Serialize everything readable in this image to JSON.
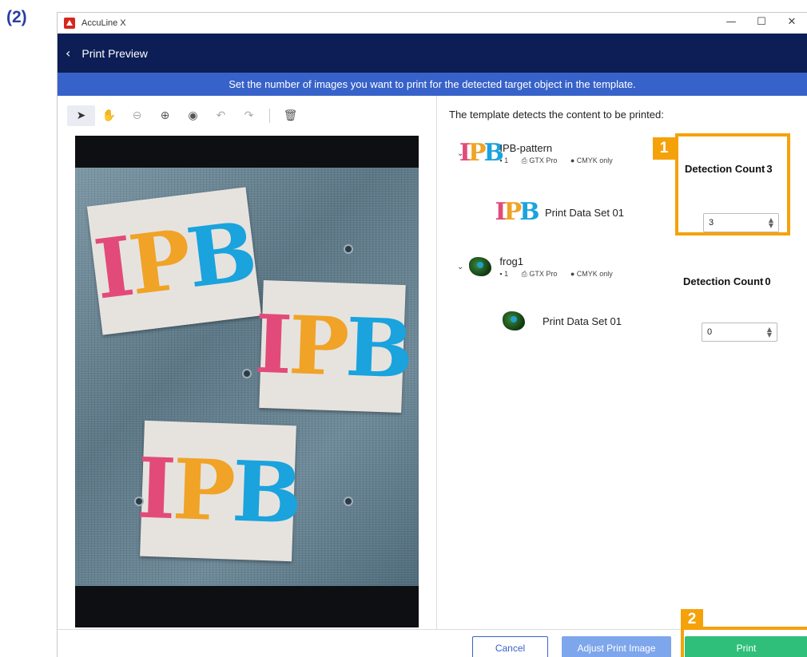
{
  "step_label": "(2)",
  "window": {
    "title": "AccuLine X",
    "controls": [
      "—",
      "☐",
      "✕"
    ]
  },
  "nav": {
    "back_icon": "‹",
    "title": "Print Preview"
  },
  "banner_text": "Set the number of images you want to print for the detected target object in the template.",
  "toolbar": {
    "tools": [
      {
        "name": "select-tool",
        "glyph": "➤"
      },
      {
        "name": "pan-tool",
        "glyph": "✋"
      },
      {
        "name": "zoom-out-tool",
        "glyph": "⊖"
      },
      {
        "name": "zoom-in-tool",
        "glyph": "⊕"
      },
      {
        "name": "preview-tool",
        "glyph": "◉"
      },
      {
        "name": "undo-tool",
        "glyph": "↶"
      },
      {
        "name": "redo-tool",
        "glyph": "↷"
      },
      {
        "name": "delete-tool",
        "glyph": "🗑"
      }
    ]
  },
  "preview_logo": {
    "p1": "I",
    "p2": "P",
    "p3": "B"
  },
  "right_panel": {
    "heading": "The template detects the content to be printed:",
    "groups": [
      {
        "name": "IPB-pattern",
        "count_label": "1",
        "printer": "GTX Pro",
        "color_mode": "CMYK only",
        "detection_label": "Detection Count",
        "detection_value": "3",
        "subitem": {
          "name": "Print Data Set 01",
          "value": "3"
        }
      },
      {
        "name": "frog1",
        "count_label": "1",
        "printer": "GTX Pro",
        "color_mode": "CMYK only",
        "detection_label": "Detection Count",
        "detection_value": "0",
        "subitem": {
          "name": "Print Data Set 01",
          "value": "0"
        }
      }
    ]
  },
  "footer": {
    "cancel": "Cancel",
    "adjust": "Adjust Print Image",
    "print": "Print"
  },
  "callouts": {
    "one": "1",
    "two": "2"
  },
  "colors": {
    "nav": "#0c1e55",
    "banner": "#3762c9",
    "print": "#2fbf7a",
    "callout": "#f5a20a"
  }
}
